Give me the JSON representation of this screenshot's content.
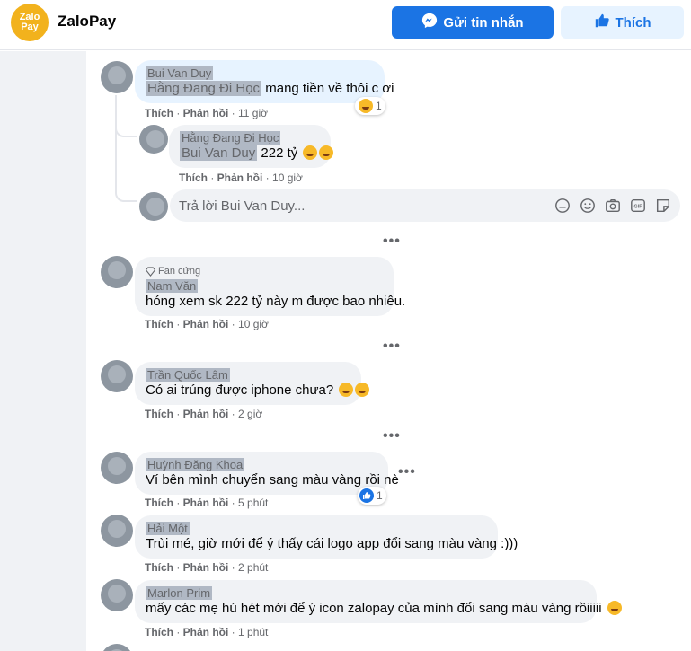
{
  "header": {
    "logo_text_top": "Zalo",
    "logo_text_bottom": "Pay",
    "page_name": "ZaloPay",
    "message_button": "Gửi tin nhắn",
    "like_button": "Thích",
    "brand_color": "#1b74e4",
    "logo_color": "#f2b21d"
  },
  "thread": {
    "comment": {
      "author": "Bui Van Duy",
      "tag": "Hằng Đang Đi Học",
      "text": " mang tiền về thôi c ơi",
      "like": "Thích",
      "reply": "Phản hồi",
      "time": "11 giờ",
      "reaction_count": "1",
      "reaction_icon": "laughing-emoji-icon"
    },
    "reply": {
      "author": "Hằng Đang Đi Học",
      "tag": "Bui Van Duy",
      "text": " 222 tỷ ",
      "like": "Thích",
      "reply": "Phản hồi",
      "time": "10 giờ"
    },
    "reply_input": {
      "placeholder": "Trả lời Bui Van Duy..."
    }
  },
  "comments": [
    {
      "badge": "Fan cứng",
      "author": "Nam Văn",
      "text": "hóng xem sk 222 tỷ này m được bao nhiêu.",
      "like": "Thích",
      "reply": "Phản hồi",
      "time": "10 giờ"
    },
    {
      "author": "Trần Quốc Lâm",
      "text": "Có ai trúng được iphone chưa? ",
      "like": "Thích",
      "reply": "Phản hồi",
      "time": "2 giờ"
    },
    {
      "author": "Huỳnh Đăng Khoa",
      "text": "Ví bên mình chuyển sang màu vàng rồi nè",
      "like": "Thích",
      "reply": "Phản hồi",
      "time": "5 phút",
      "reaction_count": "1",
      "reaction_icon": "like-reaction-icon"
    },
    {
      "author": "Hải Một",
      "text": "Trùi mé, giờ mới để ý thấy cái logo app đổi sang màu vàng :)))",
      "like": "Thích",
      "reply": "Phản hồi",
      "time": "2 phút"
    },
    {
      "author": "Marlon Prim",
      "text": "mấy các mẹ hú hét mới để ý icon zalopay của mình đổi sang màu vàng rồiiiii ",
      "like": "Thích",
      "reply": "Phản hồi",
      "time": "1 phút"
    }
  ],
  "more_icon": "more-dots-icon"
}
